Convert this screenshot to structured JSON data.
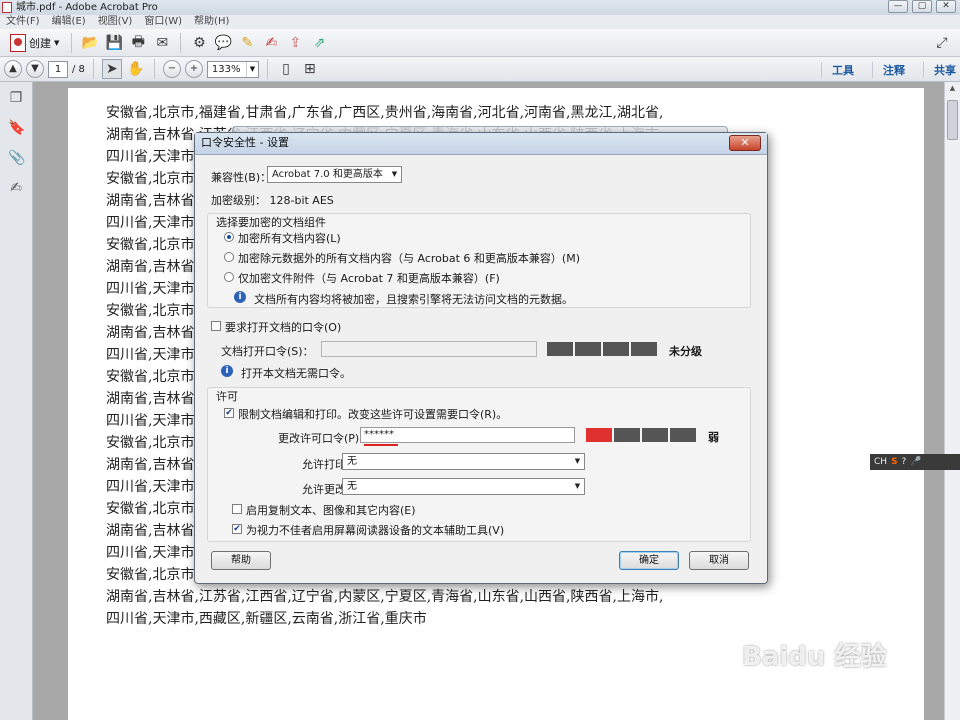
{
  "window": {
    "title": "城市.pdf - Adobe Acrobat Pro",
    "controls": [
      "—",
      "▢",
      "✕"
    ]
  },
  "menu": [
    "文件(F)",
    "编辑(E)",
    "视图(V)",
    "窗口(W)",
    "帮助(H)"
  ],
  "toolbar": {
    "create_label": "创建",
    "page_current": "1",
    "page_total": "/ 8",
    "zoom": "133%"
  },
  "panels": {
    "tools": "工具",
    "comment": "注释",
    "share": "共享"
  },
  "page_lines": [
    "安徽省,北京市,福建省,甘肃省,广东省,广西区,贵州省,海南省,河北省,河南省,黑龙江,湖北省,",
    "湖南省,吉林省,江苏省,江西省,辽宁省,内蒙区,宁夏区,青海省,山东省,山西省,陕西省,上海市,",
    "四川省,天津市,西藏区,新疆区,云南省,浙江省,重庆市",
    "安徽省,北京市,福建省,甘肃省,广东省,广西区,贵州省,海南省,河北省,河南省,黑龙江,湖北省,",
    "湖南省,吉林省,江苏省,江西省,辽宁省,内蒙区,宁夏区,青海省,山东省,山西省,陕西省,上海市,",
    "四川省,天津市,西藏区,新疆区,云南省,浙江省,重庆市",
    "安徽省,北京市,福建省,甘肃省,广东省,广西区,贵州省,海南省,河北省,河南省,黑龙江,湖北省,",
    "湖南省,吉林省,江苏省,江西省,辽宁省,内蒙区,宁夏区,青海省,山东省,山西省,陕西省,上海市,",
    "四川省,天津市,西藏区,新疆区,云南省,浙江省,重庆市",
    "安徽省,北京市,福建省,甘肃省,广东省,广西区,贵州省,海南省,河北省,河南省,黑龙江,湖北省,",
    "湖南省,吉林省,江苏省,江西省,辽宁省,内蒙区,宁夏区,青海省,山东省,山西省,陕西省,上海市,",
    "四川省,天津市,西藏区,新疆区,云南省,浙江省,重庆市",
    "安徽省,北京市,福建省,甘肃省,广东省,广西区,贵州省,海南省,河北省,河南省,黑龙江,湖北省,",
    "湖南省,吉林省,江苏省,江西省,辽宁省,内蒙区,宁夏区,青海省,山东省,山西省,陕西省,上海市,",
    "四川省,天津市,西藏区,新疆区,云南省,浙江省,重庆市",
    "安徽省,北京市,福建省,甘肃省,广东省,广西区,贵州省,海南省,河北省,河南省,黑龙江,湖北省,",
    "湖南省,吉林省,江苏省,江西省,辽宁省,内蒙区,宁夏区,青海省,山东省,山西省,陕西省,上海市,",
    "四川省,天津市,西藏区,新疆区,云南省,浙江省,重庆市",
    "安徽省,北京市,福建省,甘肃省,广东省,广西区,贵州省,海南省,河北省,河南省,黑龙江,湖北省,",
    "湖南省,吉林省,江苏省,江西省,辽宁省,内蒙区,宁夏区,青海省,山东省,山西省,陕西省,上海市,",
    "四川省,天津市,西藏区,新疆区,云南省,浙江省,重庆市",
    "安徽省,北京市,福建省,甘肃省,广东省,广西区,贵州省,海南省,河北省,河南省,黑龙江,湖北省,",
    "湖南省,吉林省,江苏省,江西省,辽宁省,内蒙区,宁夏区,青海省,山东省,山西省,陕西省,上海市,",
    "四川省,天津市,西藏区,新疆区,云南省,浙江省,重庆市"
  ],
  "dialog": {
    "title": "口令安全性 - 设置",
    "close": "✕",
    "compat_label": "兼容性(B)：",
    "compat_value": "Acrobat 7.0 和更高版本",
    "enc_level": "加密级别： 128-bit AES",
    "group_title": "选择要加密的文档组件",
    "radio_all": "加密所有文档内容(L)",
    "radio_except_meta": "加密除元数据外的所有文档内容（与 Acrobat 6 和更高版本兼容）(M)",
    "radio_attach": "仅加密文件附件（与 Acrobat 7 和更高版本兼容）(F)",
    "info_text": "文档所有内容均将被加密，且搜索引擎将无法访问文档的元数据。",
    "require_open": "要求打开文档的口令(O)",
    "open_pwd_label": "文档打开口令(S)：",
    "open_strength": "未分级",
    "open_info": "打开本文档无需口令。",
    "perm_title": "许可",
    "restrict": "限制文档编辑和打印。改变这些许可设置需要口令(R)。",
    "change_pwd_label": "更改许可口令(P)：",
    "change_pwd_value": "******",
    "strength": "弱",
    "print_label": "允许打印(N)：",
    "print_value": "无",
    "change_label": "允许更改(W)：",
    "change_value": "无",
    "copy_label": "启用复制文本、图像和其它内容(E)",
    "access_label": "为视力不佳者启用屏幕阅读器设备的文本辅助工具(V)",
    "help_btn": "帮助",
    "ok_btn": "确定",
    "cancel_btn": "取消"
  },
  "floatbar": [
    "CH",
    "S",
    "?",
    "🎤"
  ],
  "watermark": "Baidu 经验"
}
